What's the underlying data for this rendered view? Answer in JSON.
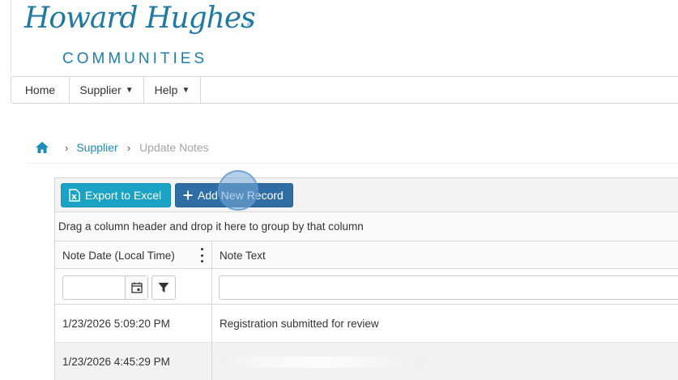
{
  "logo": {
    "script_text": "Howard Hughes",
    "registered_mark": "®",
    "subtitle": "COMMUNITIES"
  },
  "nav": {
    "items": [
      {
        "label": "Home",
        "has_dropdown": false
      },
      {
        "label": "Supplier",
        "has_dropdown": true
      },
      {
        "label": "Help",
        "has_dropdown": true
      }
    ]
  },
  "breadcrumb": {
    "home_icon": "home-icon",
    "items": [
      "Supplier",
      "Update Notes"
    ]
  },
  "grid": {
    "toolbar": {
      "export_label": "Export to Excel",
      "add_label": "Add New Record"
    },
    "group_hint": "Drag a column header and drop it here to group by that column",
    "columns": [
      "Note Date (Local Time)",
      "Note Text"
    ],
    "filters": {
      "date_value": "",
      "text_value": ""
    },
    "rows": [
      {
        "date": "1/23/2026 5:09:20 PM",
        "text": "Registration submitted for review"
      },
      {
        "date": "1/23/2026 4:45:29 PM",
        "text": ""
      }
    ]
  },
  "colors": {
    "brand": "#1f79a3",
    "excel_button": "#1ba3c6",
    "add_button": "#2f6ea5",
    "link": "#1e8cb8"
  }
}
